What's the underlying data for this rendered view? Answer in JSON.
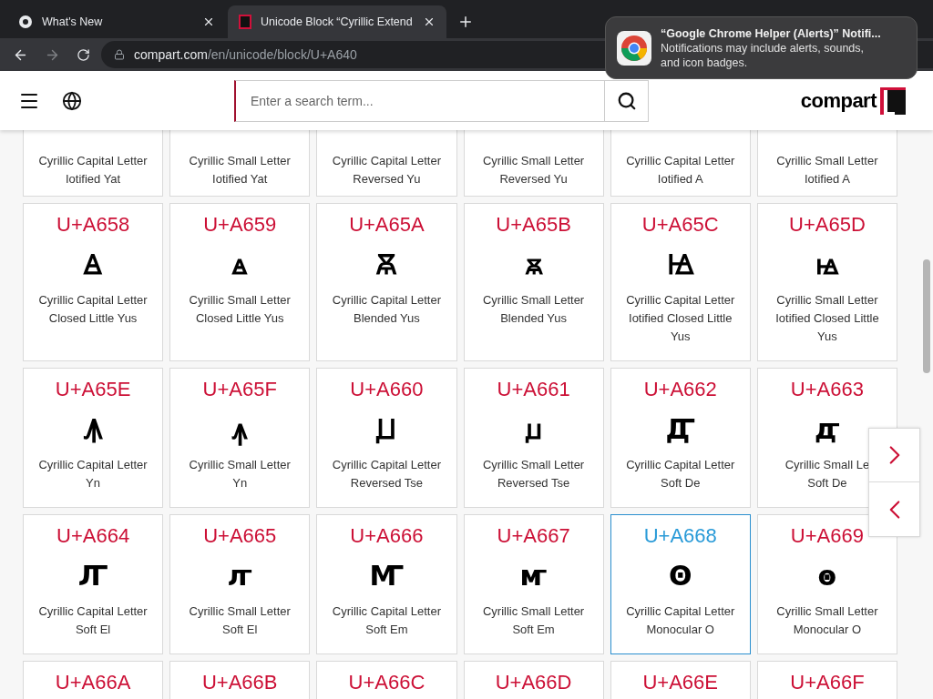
{
  "browser": {
    "tabs": [
      {
        "title": "What's New",
        "selected": false
      },
      {
        "title": "Unicode Block “Cyrillic Extend",
        "selected": true
      }
    ],
    "address": {
      "host": "compart.com",
      "path": "/en/unicode/block/U+A640"
    }
  },
  "notification": {
    "title": "“Google Chrome Helper (Alerts)” Notifi...",
    "body": "Notifications may include alerts, sounds, and icon badges."
  },
  "header": {
    "search": {
      "placeholder": "Enter a search term..."
    },
    "logo": "compart"
  },
  "rows": [
    {
      "kind": "cut-top",
      "cells": [
        {
          "lines": [
            "Cyrillic Capital Letter",
            "Iotified Yat"
          ],
          "selected": false
        },
        {
          "lines": [
            "Cyrillic Small Letter",
            "Iotified Yat"
          ],
          "selected": false
        },
        {
          "lines": [
            "Cyrillic Capital Letter",
            "Reversed Yu"
          ],
          "selected": false
        },
        {
          "lines": [
            "Cyrillic Small Letter",
            "Reversed Yu"
          ],
          "selected": false
        },
        {
          "lines": [
            "Cyrillic Capital Letter",
            "Iotified A"
          ],
          "selected": false
        },
        {
          "lines": [
            "Cyrillic Small Letter",
            "Iotified A"
          ],
          "selected": false
        }
      ]
    },
    {
      "kind": "full",
      "cells": [
        {
          "code": "U+A658",
          "glyph": "Ꙙ",
          "lines": [
            "Cyrillic Capital Letter",
            "Closed Little Yus"
          ],
          "selected": false
        },
        {
          "code": "U+A659",
          "glyph": "ꙙ",
          "lines": [
            "Cyrillic Small Letter",
            "Closed Little Yus"
          ],
          "selected": false
        },
        {
          "code": "U+A65A",
          "glyph": "Ꙛ",
          "lines": [
            "Cyrillic Capital Letter",
            "Blended Yus"
          ],
          "selected": false
        },
        {
          "code": "U+A65B",
          "glyph": "ꙛ",
          "lines": [
            "Cyrillic Small Letter",
            "Blended Yus"
          ],
          "selected": false
        },
        {
          "code": "U+A65C",
          "glyph": "Ꙝ",
          "lines": [
            "Cyrillic Capital Letter",
            "Iotified Closed Little",
            "Yus"
          ],
          "selected": false
        },
        {
          "code": "U+A65D",
          "glyph": "ꙝ",
          "lines": [
            "Cyrillic Small Letter",
            "Iotified Closed Little",
            "Yus"
          ],
          "selected": false
        }
      ]
    },
    {
      "kind": "full",
      "cells": [
        {
          "code": "U+A65E",
          "glyph": "Ꙟ",
          "lines": [
            "Cyrillic Capital Letter",
            "Yn"
          ],
          "selected": false
        },
        {
          "code": "U+A65F",
          "glyph": "ꙟ",
          "lines": [
            "Cyrillic Small Letter",
            "Yn"
          ],
          "selected": false
        },
        {
          "code": "U+A660",
          "glyph": "Ꙡ",
          "lines": [
            "Cyrillic Capital Letter",
            "Reversed Tse"
          ],
          "selected": false
        },
        {
          "code": "U+A661",
          "glyph": "ꙡ",
          "lines": [
            "Cyrillic Small Letter",
            "Reversed Tse"
          ],
          "selected": false
        },
        {
          "code": "U+A662",
          "glyph": "Ꙣ",
          "lines": [
            "Cyrillic Capital Letter",
            "Soft De"
          ],
          "selected": false
        },
        {
          "code": "U+A663",
          "glyph": "ꙣ",
          "lines": [
            "Cyrillic Small Le",
            "Soft De"
          ],
          "selected": false
        }
      ]
    },
    {
      "kind": "full",
      "cells": [
        {
          "code": "U+A664",
          "glyph": "Ꙥ",
          "lines": [
            "Cyrillic Capital Letter",
            "Soft El"
          ],
          "selected": false
        },
        {
          "code": "U+A665",
          "glyph": "ꙥ",
          "lines": [
            "Cyrillic Small Letter",
            "Soft El"
          ],
          "selected": false
        },
        {
          "code": "U+A666",
          "glyph": "Ꙧ",
          "lines": [
            "Cyrillic Capital Letter",
            "Soft Em"
          ],
          "selected": false
        },
        {
          "code": "U+A667",
          "glyph": "ꙧ",
          "lines": [
            "Cyrillic Small Letter",
            "Soft Em"
          ],
          "selected": false
        },
        {
          "code": "U+A668",
          "glyph": "Ꙩ",
          "lines": [
            "Cyrillic Capital Letter",
            "Monocular O"
          ],
          "selected": true
        },
        {
          "code": "U+A669",
          "glyph": "ꙩ",
          "lines": [
            "Cyrillic Small Letter",
            "Monocular O"
          ],
          "selected": false
        }
      ]
    },
    {
      "kind": "cut-bottom",
      "cells": [
        {
          "code": "U+A66A",
          "selected": false
        },
        {
          "code": "U+A66B",
          "selected": false
        },
        {
          "code": "U+A66C",
          "selected": false
        },
        {
          "code": "U+A66D",
          "selected": false
        },
        {
          "code": "U+A66E",
          "selected": false
        },
        {
          "code": "U+A66F",
          "selected": false
        }
      ]
    }
  ]
}
